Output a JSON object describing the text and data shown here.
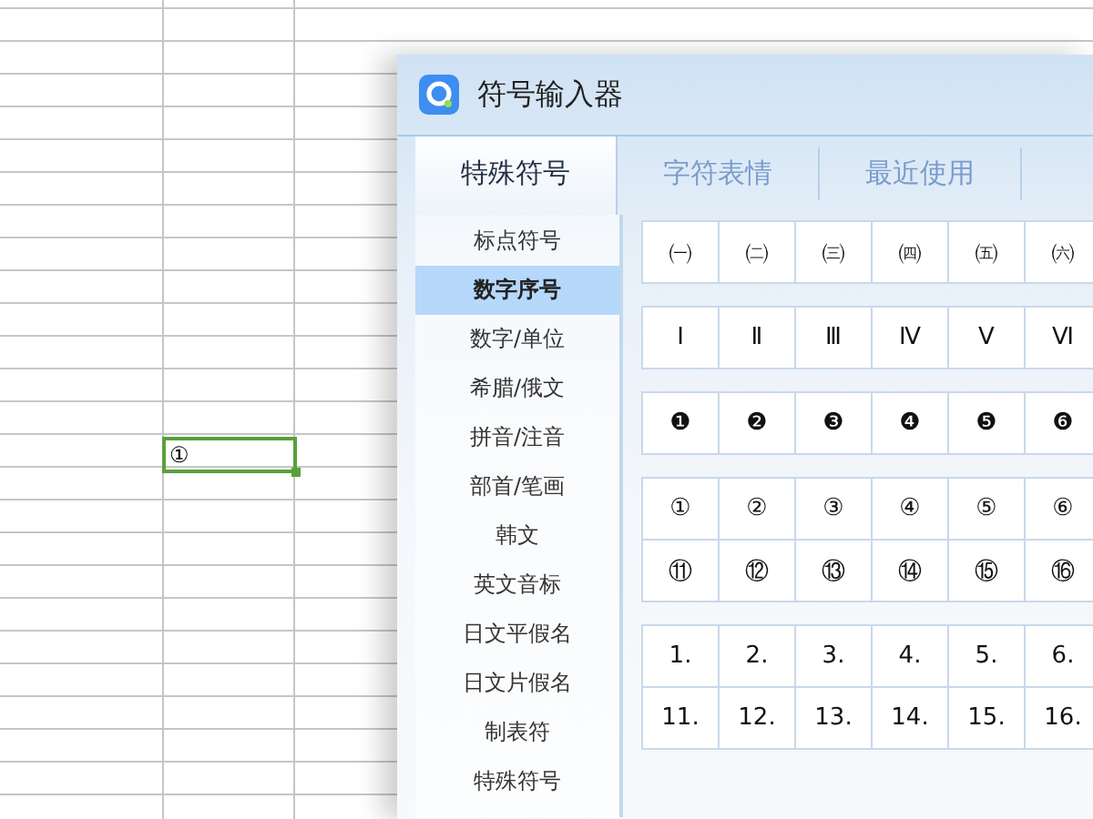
{
  "sheet": {
    "active_cell": "①"
  },
  "dialog": {
    "title": "符号输入器",
    "tabs": [
      {
        "label": "特殊符号",
        "selected": true
      },
      {
        "label": "字符表情",
        "selected": false
      },
      {
        "label": "最近使用",
        "selected": false
      }
    ],
    "categories": [
      {
        "label": "标点符号",
        "selected": false
      },
      {
        "label": "数字序号",
        "selected": true
      },
      {
        "label": "数字/单位",
        "selected": false
      },
      {
        "label": "希腊/俄文",
        "selected": false
      },
      {
        "label": "拼音/注音",
        "selected": false
      },
      {
        "label": "部首/笔画",
        "selected": false
      },
      {
        "label": "韩文",
        "selected": false
      },
      {
        "label": "英文音标",
        "selected": false
      },
      {
        "label": "日文平假名",
        "selected": false
      },
      {
        "label": "日文片假名",
        "selected": false
      },
      {
        "label": "制表符",
        "selected": false
      },
      {
        "label": "特殊符号",
        "selected": false
      }
    ],
    "symbol_groups": [
      [
        [
          "㈠",
          "㈡",
          "㈢",
          "㈣",
          "㈤",
          "㈥"
        ]
      ],
      [
        [
          "Ⅰ",
          "Ⅱ",
          "Ⅲ",
          "Ⅳ",
          "Ⅴ",
          "Ⅵ"
        ]
      ],
      [
        [
          "❶",
          "❷",
          "❸",
          "❹",
          "❺",
          "❻"
        ]
      ],
      [
        [
          "①",
          "②",
          "③",
          "④",
          "⑤",
          "⑥"
        ],
        [
          "⑪",
          "⑫",
          "⑬",
          "⑭",
          "⑮",
          "⑯"
        ]
      ],
      [
        [
          "1.",
          "2.",
          "3.",
          "4.",
          "5.",
          "6."
        ],
        [
          "11.",
          "12.",
          "13.",
          "14.",
          "15.",
          "16."
        ]
      ]
    ]
  }
}
